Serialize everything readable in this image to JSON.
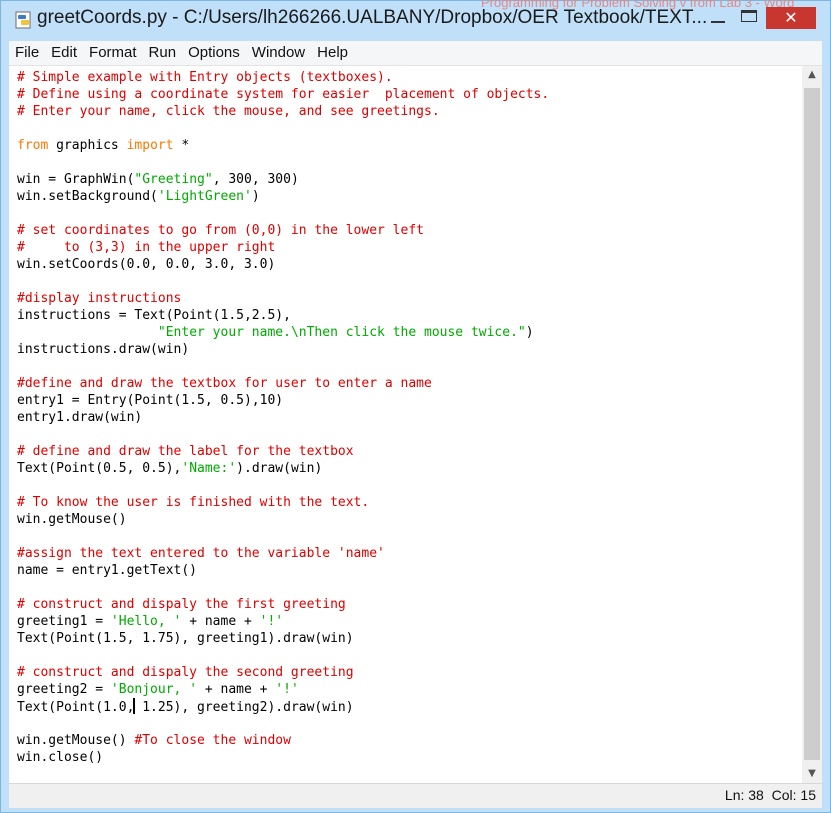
{
  "window": {
    "title": "greetCoords.py - C:/Users/lh266266.UALBANY/Dropbox/OER Textbook/TEXT...",
    "background_text": "Programming for Problem Solving v from Lab 3 - Word",
    "close_symbol": "✕"
  },
  "menu": [
    "File",
    "Edit",
    "Format",
    "Run",
    "Options",
    "Window",
    "Help"
  ],
  "code_lines": [
    [
      [
        "c",
        "# Simple example with Entry objects (textboxes)."
      ]
    ],
    [
      [
        "c",
        "# Define using a coordinate system for easier  placement of objects."
      ]
    ],
    [
      [
        "c",
        "# Enter your name, click the mouse, and see greetings."
      ]
    ],
    [],
    [
      [
        "k",
        "from"
      ],
      [
        "n",
        " graphics "
      ],
      [
        "k",
        "import"
      ],
      [
        "n",
        " *"
      ]
    ],
    [],
    [
      [
        "n",
        "win = GraphWin("
      ],
      [
        "s",
        "\"Greeting\""
      ],
      [
        "n",
        ", 300, 300)"
      ]
    ],
    [
      [
        "n",
        "win.setBackground("
      ],
      [
        "s",
        "'LightGreen'"
      ],
      [
        "n",
        ")"
      ]
    ],
    [],
    [
      [
        "c",
        "# set coordinates to go from (0,0) in the lower left"
      ]
    ],
    [
      [
        "c",
        "#     to (3,3) in the upper right"
      ]
    ],
    [
      [
        "n",
        "win.setCoords(0.0, 0.0, 3.0, 3.0)"
      ]
    ],
    [],
    [
      [
        "c",
        "#display instructions"
      ]
    ],
    [
      [
        "n",
        "instructions = Text(Point(1.5,2.5),"
      ]
    ],
    [
      [
        "n",
        "                  "
      ],
      [
        "s",
        "\"Enter your name.\\nThen click the mouse twice.\""
      ],
      [
        "n",
        ")"
      ]
    ],
    [
      [
        "n",
        "instructions.draw(win)"
      ]
    ],
    [],
    [
      [
        "c",
        "#define and draw the textbox for user to enter a name"
      ]
    ],
    [
      [
        "n",
        "entry1 = Entry(Point(1.5, 0.5),10)"
      ]
    ],
    [
      [
        "n",
        "entry1.draw(win)"
      ]
    ],
    [],
    [
      [
        "c",
        "# define and draw the label for the textbox"
      ]
    ],
    [
      [
        "n",
        "Text(Point(0.5, 0.5),"
      ],
      [
        "s",
        "'Name:'"
      ],
      [
        "n",
        ").draw(win)"
      ]
    ],
    [],
    [
      [
        "c",
        "# To know the user is finished with the text."
      ]
    ],
    [
      [
        "n",
        "win.getMouse()"
      ]
    ],
    [],
    [
      [
        "c",
        "#assign the text entered to the variable 'name'"
      ]
    ],
    [
      [
        "n",
        "name = entry1.getText()"
      ]
    ],
    [],
    [
      [
        "c",
        "# construct and dispaly the first greeting"
      ]
    ],
    [
      [
        "n",
        "greeting1 = "
      ],
      [
        "s",
        "'Hello, '"
      ],
      [
        "n",
        " + name + "
      ],
      [
        "s",
        "'!'"
      ]
    ],
    [
      [
        "n",
        "Text(Point(1.5, 1.75), greeting1).draw(win)"
      ]
    ],
    [],
    [
      [
        "c",
        "# construct and dispaly the second greeting"
      ]
    ],
    [
      [
        "n",
        "greeting2 = "
      ],
      [
        "s",
        "'Bonjour, '"
      ],
      [
        "n",
        " + name + "
      ],
      [
        "s",
        "'!'"
      ]
    ],
    [
      [
        "n",
        "Text(Point(1.0,"
      ],
      [
        "caret",
        ""
      ],
      [
        "n",
        " 1.25), greeting2).draw(win)"
      ]
    ],
    [],
    [
      [
        "n",
        "win.getMouse() "
      ],
      [
        "c",
        "#To close the window"
      ]
    ],
    [
      [
        "n",
        "win.close()"
      ]
    ]
  ],
  "status": {
    "line": "Ln: 38",
    "col": "Col: 15"
  }
}
